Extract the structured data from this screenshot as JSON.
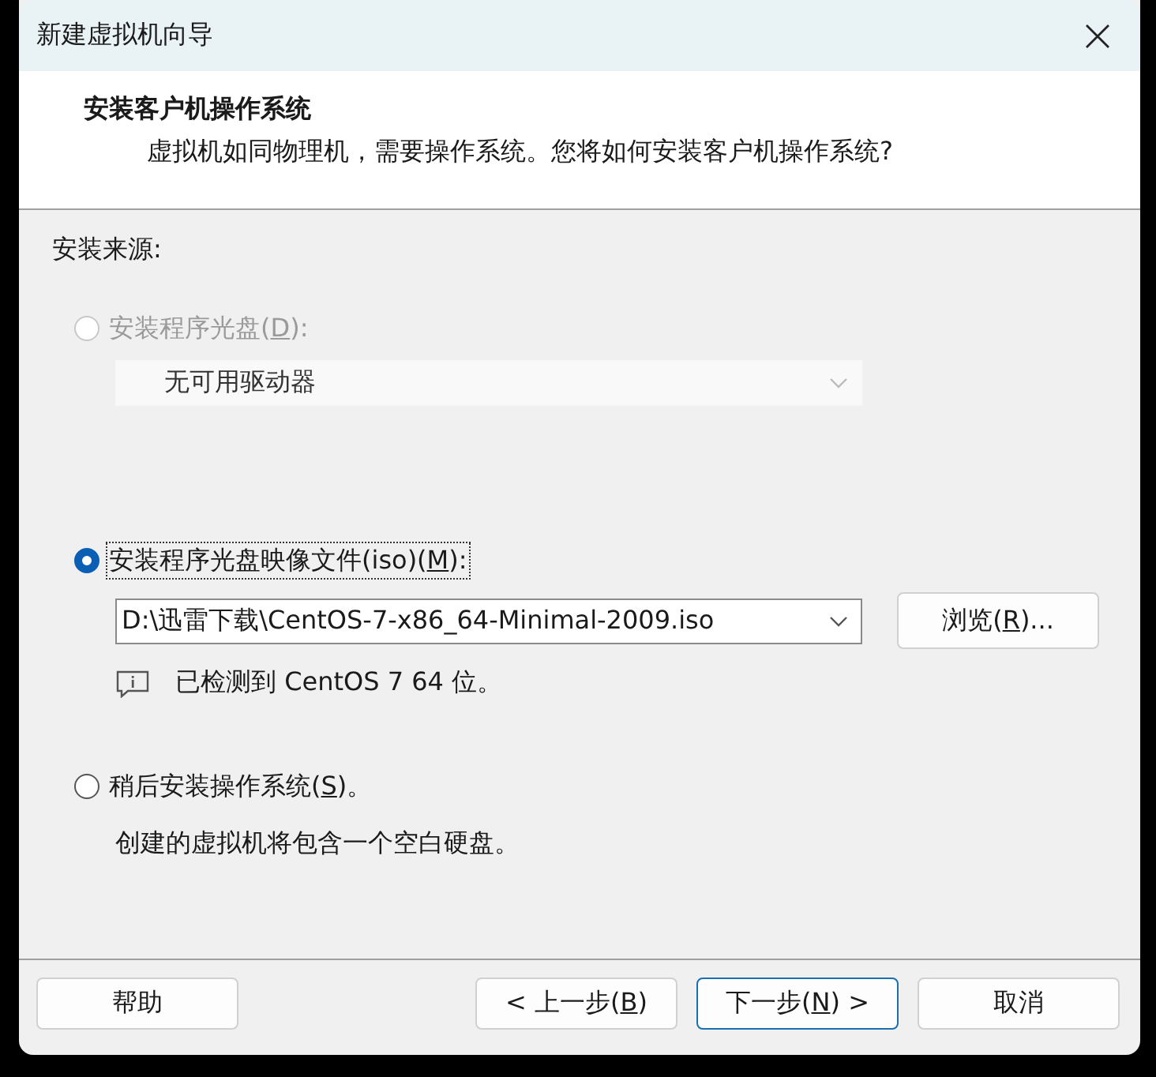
{
  "window": {
    "title": "新建虚拟机向导"
  },
  "header": {
    "title": "安装客户机操作系统",
    "subtitle": "虚拟机如同物理机，需要操作系统。您将如何安装客户机操作系统?"
  },
  "source_label": "安装来源:",
  "options": [
    {
      "label": {
        "before": "安装程序光盘(",
        "key": "D",
        "after": "):"
      },
      "selected": false,
      "disabled": true,
      "focused": false,
      "dropdown": {
        "value": "无可用驱动器",
        "disabled": true
      }
    },
    {
      "label": {
        "before": "安装程序光盘映像文件(iso)(",
        "key": "M",
        "after": "):"
      },
      "selected": true,
      "disabled": false,
      "focused": true,
      "dropdown": {
        "value": "D:\\迅雷下载\\CentOS-7-x86_64-Minimal-2009.iso",
        "disabled": false
      },
      "browse_button": {
        "before": "浏览(",
        "key": "R",
        "after": ")..."
      },
      "info": "已检测到 CentOS 7 64 位。"
    },
    {
      "label": {
        "before": "稍后安装操作系统(",
        "key": "S",
        "after": ")。"
      },
      "selected": false,
      "disabled": false,
      "focused": false,
      "note": "创建的虚拟机将包含一个空白硬盘。"
    }
  ],
  "help_button": {
    "before": "帮助"
  },
  "nav_buttons": [
    {
      "before": "< 上一步(",
      "key": "B",
      "after": ")",
      "default": false
    },
    {
      "before": "下一步(",
      "key": "N",
      "after": ") >",
      "default": true
    },
    {
      "before": "取消",
      "default": false
    }
  ]
}
